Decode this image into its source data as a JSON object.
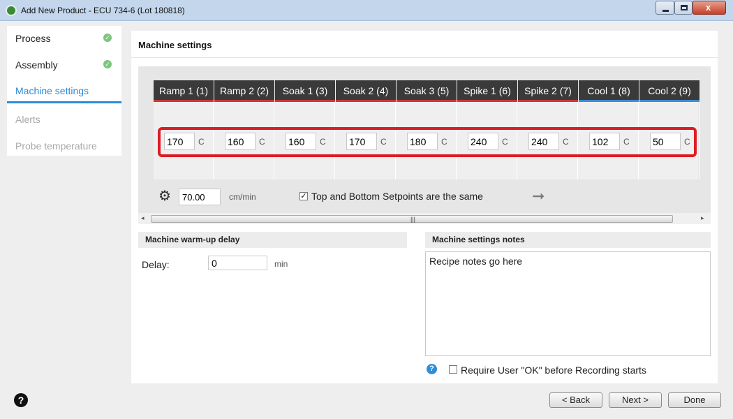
{
  "window": {
    "title": "Add New Product - ECU 734-6 (Lot 180818)",
    "close_glyph": "x"
  },
  "sidebar": {
    "items": [
      {
        "label": "Process",
        "state": "completed",
        "check": "✓"
      },
      {
        "label": "Assembly",
        "state": "completed",
        "check": "✓"
      },
      {
        "label": "Machine settings",
        "state": "active"
      },
      {
        "label": "Alerts",
        "state": "disabled"
      },
      {
        "label": "Probe temperature",
        "state": "disabled"
      }
    ],
    "help_glyph": "?"
  },
  "main": {
    "title": "Machine settings",
    "zones": [
      {
        "label": "Ramp 1 (1)",
        "value": "170",
        "unit": "C",
        "kind": "heat"
      },
      {
        "label": "Ramp 2 (2)",
        "value": "160",
        "unit": "C",
        "kind": "heat"
      },
      {
        "label": "Soak 1 (3)",
        "value": "160",
        "unit": "C",
        "kind": "heat"
      },
      {
        "label": "Soak 2 (4)",
        "value": "170",
        "unit": "C",
        "kind": "heat"
      },
      {
        "label": "Soak 3 (5)",
        "value": "180",
        "unit": "C",
        "kind": "heat"
      },
      {
        "label": "Spike 1 (6)",
        "value": "240",
        "unit": "C",
        "kind": "heat"
      },
      {
        "label": "Spike 2 (7)",
        "value": "240",
        "unit": "C",
        "kind": "heat"
      },
      {
        "label": "Cool 1 (8)",
        "value": "102",
        "unit": "C",
        "kind": "cool"
      },
      {
        "label": "Cool 2 (9)",
        "value": "50",
        "unit": "C",
        "kind": "cool"
      }
    ],
    "zone_colors": {
      "heat": "#d23535",
      "cool": "#3f8ad6"
    },
    "conveyor": {
      "speed": "70.00",
      "unit": "cm/min"
    },
    "same_setpoints": {
      "label": "Top and Bottom Setpoints are the same",
      "checked": true,
      "glyph": "✓"
    },
    "icons": {
      "gear": "⚙",
      "arrow": "➞",
      "grip": "|||",
      "left": "◂",
      "right": "▸"
    },
    "warmup": {
      "title": "Machine warm-up delay",
      "label": "Delay:",
      "value": "0",
      "unit": "min"
    },
    "notes": {
      "title": "Machine settings notes",
      "text": "Recipe notes go here",
      "require_ok": {
        "label": "Require User \"OK\" before Recording starts",
        "checked": false
      },
      "info_glyph": "?"
    }
  },
  "footer": {
    "back": "< Back",
    "next": "Next >",
    "done": "Done"
  }
}
